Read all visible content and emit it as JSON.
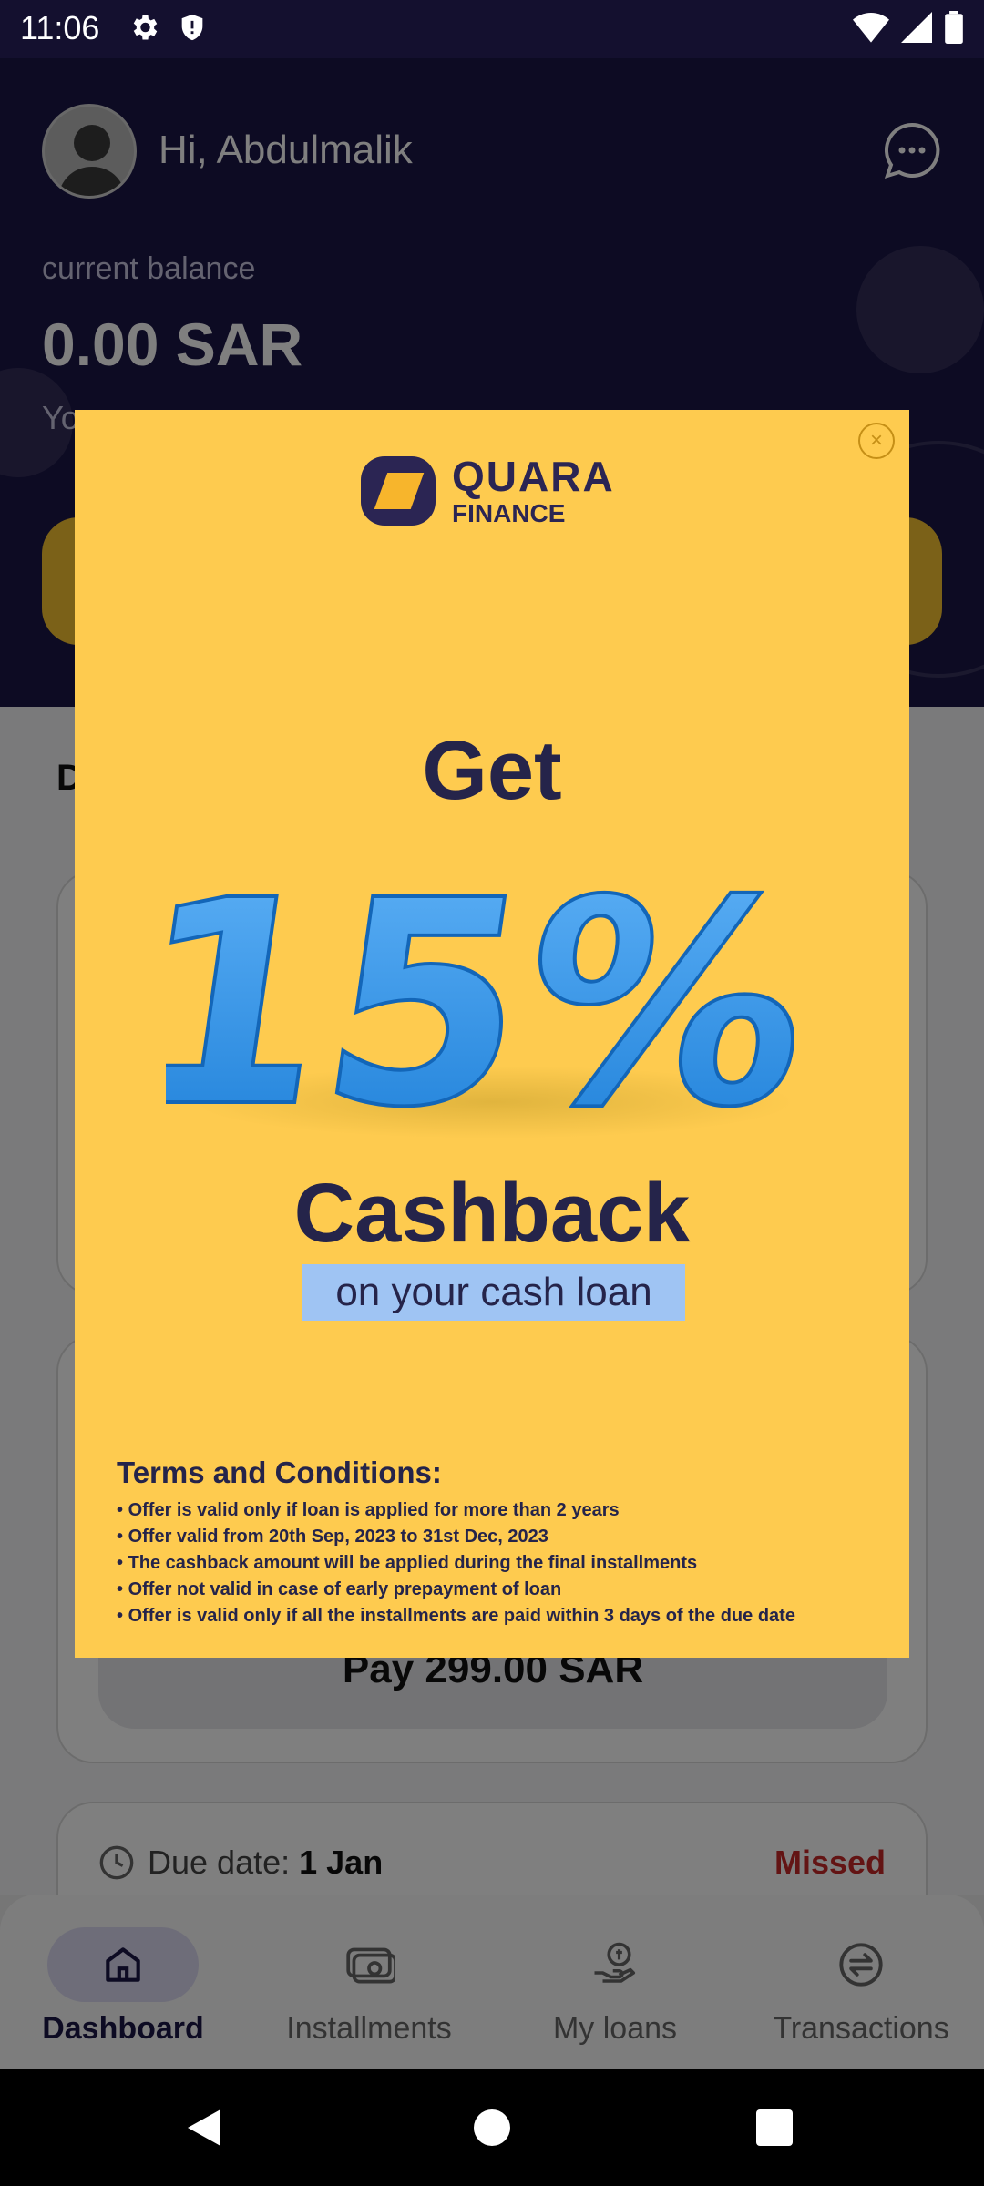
{
  "status_bar": {
    "time": "11:06",
    "left_icons": [
      "gear-icon",
      "shield-icon"
    ],
    "right_icons": [
      "wifi-icon",
      "signal-icon",
      "battery-icon"
    ]
  },
  "header": {
    "greeting": "Hi, Abdulmalik",
    "balance_label": "current balance",
    "balance_value": "0.00 SAR",
    "balance_sub_partial": "Yo"
  },
  "main": {
    "section_title_partial": "D",
    "cards": [
      {
        "pay_label": "Pay 299.00 SAR"
      },
      {
        "due_label": "Due date:",
        "due_value": "1 Jan",
        "status": "Missed"
      }
    ]
  },
  "bottom_nav": {
    "items": [
      {
        "label": "Dashboard",
        "icon": "home-icon",
        "active": true
      },
      {
        "label": "Installments",
        "icon": "cash-icon",
        "active": false
      },
      {
        "label": "My loans",
        "icon": "loan-hand-icon",
        "active": false
      },
      {
        "label": "Transactions",
        "icon": "exchange-icon",
        "active": false
      }
    ]
  },
  "popup": {
    "brand_name": "QUARA",
    "brand_sub": "FINANCE",
    "get": "Get",
    "percent": "15%",
    "cashback": "Cashback",
    "tagline": "on your cash loan",
    "terms_title": "Terms and Conditions:",
    "terms": [
      "Offer is valid only if loan is applied for more than 2 years",
      "Offer valid from 20th Sep, 2023 to 31st Dec, 2023",
      "The cashback amount will be applied during the final installments",
      "Offer not valid in case of early prepayment of loan",
      "Offer is valid only if all the installments are paid within 3 days of the due date"
    ],
    "close_glyph": "×"
  },
  "colors": {
    "header_bg": "#1b1647",
    "popup_bg": "#fecb4f",
    "accent_blue": "#2a8ee6",
    "missed": "#c62828"
  }
}
